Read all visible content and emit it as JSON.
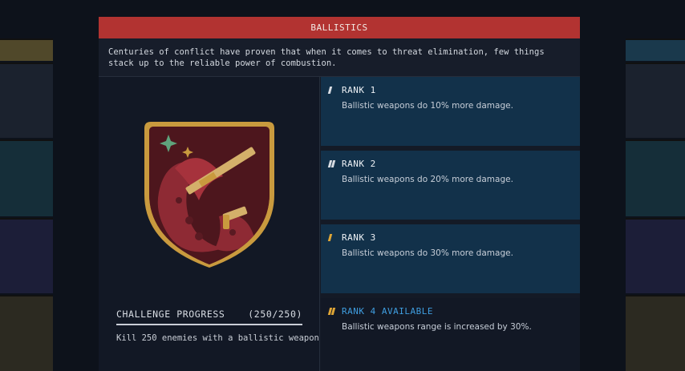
{
  "panel": {
    "title": "BALLISTICS",
    "description": "Centuries of conflict have proven that when it comes to threat elimination, few things stack up to the reliable power of combustion."
  },
  "challenge": {
    "label": "CHALLENGE PROGRESS",
    "count": "(250/250)",
    "progress": 1.0,
    "text": "Kill 250 enemies with a ballistic weapon"
  },
  "ranks": [
    {
      "title": "RANK 1",
      "desc": "Ballistic weapons do 10% more damage.",
      "pips": 1,
      "pip_color": "#d9dde3"
    },
    {
      "title": "RANK 2",
      "desc": "Ballistic weapons do 20% more damage.",
      "pips": 2,
      "pip_color": "#d9dde3"
    },
    {
      "title": "RANK 3",
      "desc": "Ballistic weapons do 30% more damage.",
      "pips": 1,
      "pip_color": "#e0a636"
    },
    {
      "title": "RANK 4 AVAILABLE",
      "desc": "Ballistic weapons range is increased by 30%.",
      "pips": 2,
      "pip_color": "#e0a636"
    }
  ],
  "colors": {
    "title_bar": "#b23331",
    "rank_unlocked": "#12314a",
    "rank_available_text": "#3f9ee0"
  },
  "badge": {
    "icon": "ballistics-badge-icon"
  }
}
